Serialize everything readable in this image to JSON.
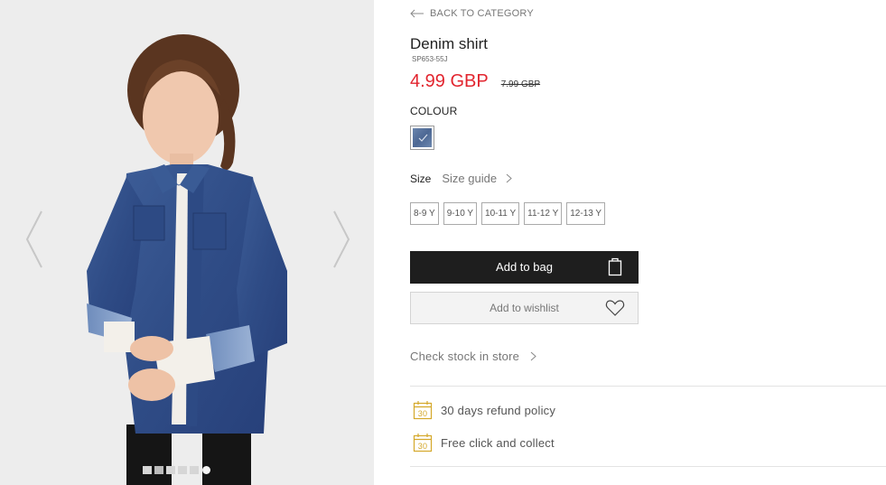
{
  "gallery": {
    "dots_count": 6,
    "active_dot": 1
  },
  "product": {
    "back_link": "BACK TO CATEGORY",
    "title": "Denim shirt",
    "sku": "SP653-55J",
    "price": "4.99 GBP",
    "old_price": "7.99 GBP",
    "colour_label": "COLOUR",
    "size_label": "Size",
    "size_guide": "Size guide",
    "sizes": [
      "8-9 Y",
      "9-10 Y",
      "10-11 Y",
      "11-12 Y",
      "12-13 Y"
    ],
    "add_to_bag": "Add to bag",
    "add_to_wishlist": "Add to wishlist",
    "check_stock": "Check stock in store"
  },
  "perks": {
    "refund": "30 days refund policy",
    "collect": "Free click and collect",
    "calendar_number": "30"
  },
  "colors": {
    "price": "#e2252f",
    "button_dark": "#1e1e1e",
    "perk_icon": "#d4a82a"
  }
}
